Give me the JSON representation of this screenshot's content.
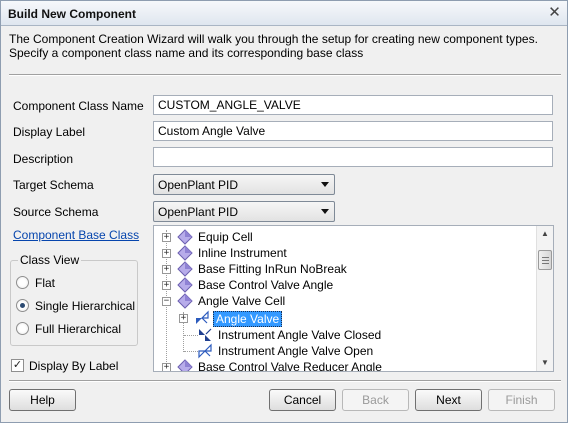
{
  "window": {
    "title": "Build New Component",
    "close_glyph": "✕"
  },
  "intro_text": "The Component Creation Wizard will walk you through the setup for creating new component types.  Specify a component class name and its corresponding base class",
  "form": {
    "class_name_label": "Component Class Name",
    "class_name_value": "CUSTOM_ANGLE_VALVE",
    "display_label_label": "Display Label",
    "display_label_value": "Custom Angle Valve",
    "description_label": "Description",
    "description_value": "",
    "target_schema_label": "Target Schema",
    "target_schema_value": "OpenPlant PID",
    "source_schema_label": "Source Schema",
    "source_schema_value": "OpenPlant PID",
    "base_class_link": "Component Base Class"
  },
  "class_view": {
    "title": "Class View",
    "options": [
      {
        "label": "Flat",
        "selected": false
      },
      {
        "label": "Single Hierarchical",
        "selected": true
      },
      {
        "label": "Full Hierarchical",
        "selected": false
      }
    ]
  },
  "display_by_label": {
    "label": "Display By Label",
    "checked": true
  },
  "tree": {
    "items": [
      {
        "label": "Equip Cell",
        "icon": "purple-diamond-icon",
        "expander": "+"
      },
      {
        "label": "Inline Instrument",
        "icon": "purple-diamond-icon",
        "expander": "+"
      },
      {
        "label": "Base Fitting InRun NoBreak",
        "icon": "purple-diamond-icon",
        "expander": "+"
      },
      {
        "label": "Base Control Valve Angle",
        "icon": "purple-diamond-icon",
        "expander": "+"
      },
      {
        "label": "Angle Valve Cell",
        "icon": "purple-diamond-icon",
        "expander": "−"
      },
      {
        "label": "Angle Valve",
        "icon": "angle-valve-icon",
        "expander": "+",
        "selected": true
      },
      {
        "label": "Instrument Angle Valve Closed",
        "icon": "angle-valve-closed-icon",
        "expander": ""
      },
      {
        "label": "Instrument Angle Valve Open",
        "icon": "angle-valve-open-icon",
        "expander": ""
      },
      {
        "label": "Base Control Valve Reducer Angle",
        "icon": "purple-diamond-icon",
        "expander": "+"
      }
    ]
  },
  "buttons": {
    "help": "Help",
    "cancel": "Cancel",
    "back": "Back",
    "next": "Next",
    "finish": "Finish"
  },
  "colors": {
    "selection": "#3399ff",
    "link": "#0645ad",
    "diamond": "#9b8fd0"
  }
}
